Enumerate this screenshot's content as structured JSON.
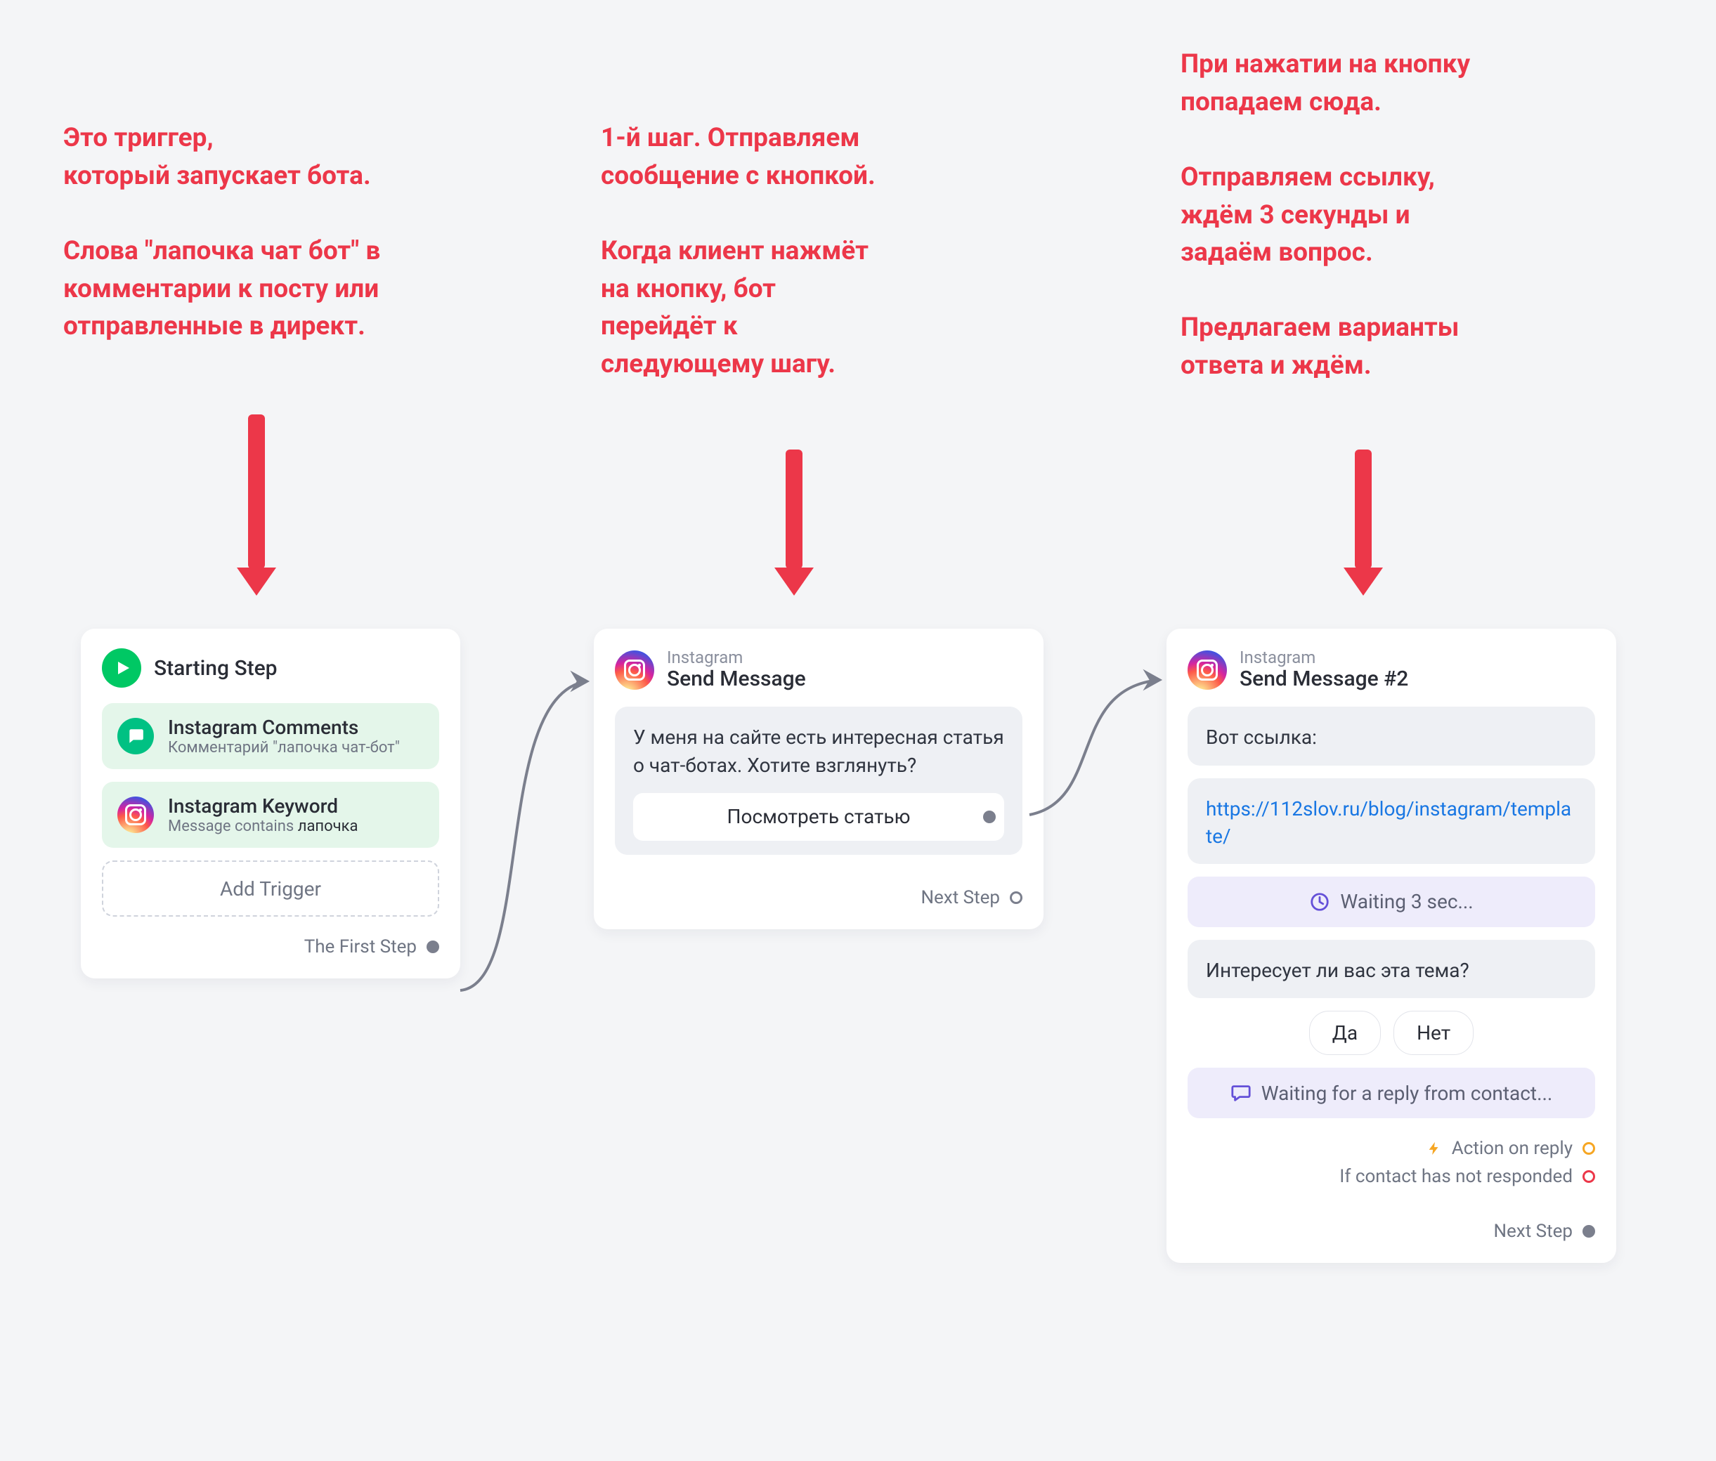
{
  "annotation": {
    "a1": "Это триггер,\nкоторый запускает бота.\n\nСлова \"лапочка чат бот\" в\nкомментарии к посту или\nотправленные в директ.",
    "a2": "1-й шаг. Отправляем\nсообщение с кнопкой.\n\nКогда клиент нажмёт\nна кнопку, бот\nперейдёт к\nследующему шагу.",
    "a3": "При нажатии на кнопку\nпопадаем сюда.\n\nОтправляем ссылку,\nждём 3 секунды и\nзадаём вопрос.\n\nПредлагаем варианты\nответа и ждём."
  },
  "card1": {
    "title": "Starting Step",
    "trigger1": {
      "title": "Instagram Comments",
      "sub": "Комментарий \"лапочка чат-бот\""
    },
    "trigger2": {
      "title": "Instagram Keyword",
      "sub_prefix": "Message contains ",
      "sub_keyword": "лапочка"
    },
    "add_trigger": "Add Trigger",
    "footer": "The First Step"
  },
  "card2": {
    "channel": "Instagram",
    "title": "Send Message",
    "msg": "У меня на сайте есть интересная статья о чат-ботах. Хотите взглянуть?",
    "button": "Посмотреть статью",
    "footer": "Next Step"
  },
  "card3": {
    "channel": "Instagram",
    "title": "Send Message #2",
    "msg1": "Вот ссылка:",
    "link": "https://112slov.ru/blog/instagram/template/",
    "waiting": "Waiting 3 sec...",
    "msg2": "Интересует ли вас эта тема?",
    "chip_yes": "Да",
    "chip_no": "Нет",
    "waiting_reply": "Waiting for a reply from contact...",
    "action_reply": "Action on reply",
    "not_responded": "If contact has not responded",
    "footer": "Next Step"
  }
}
